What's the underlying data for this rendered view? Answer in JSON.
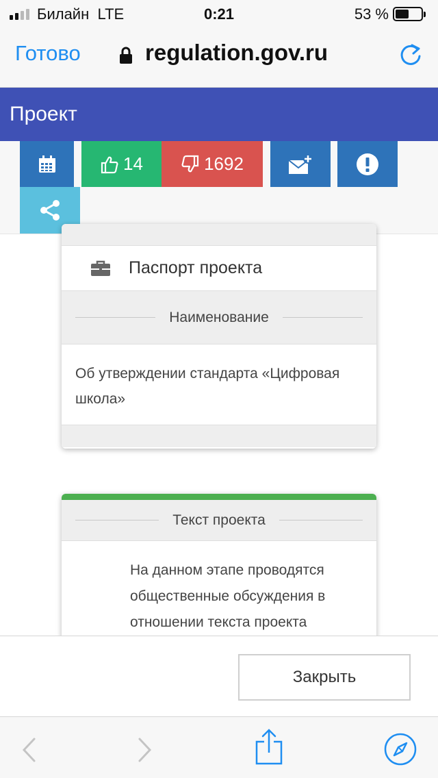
{
  "status_bar": {
    "carrier": "Билайн",
    "network": "LTE",
    "time": "0:21",
    "battery_percent": "53 %",
    "battery_level": 0.53,
    "signal_bars_filled": 2,
    "signal_bars_total": 4
  },
  "browser": {
    "done_label": "Готово",
    "url": "regulation.gov.ru",
    "lock_icon": "lock-icon",
    "reload_icon": "reload-icon"
  },
  "page": {
    "title": "Проект",
    "header_color": "#3f51b5"
  },
  "toolbar": {
    "calendar_icon": "calendar-icon",
    "likes": "14",
    "dislikes": "1692",
    "subscribe_icon": "envelope-plus-icon",
    "complaint_icon": "exclamation-icon",
    "share_icon": "share-icon",
    "colors": {
      "blue": "#2e73b9",
      "green": "#26b772",
      "red": "#d9534f",
      "light_blue": "#5bc0de"
    }
  },
  "passport_card": {
    "title": "Паспорт проекта",
    "icon": "briefcase-icon",
    "section_label": "Наименование",
    "name_text": "Об утверждении стандарта «Цифровая школа»"
  },
  "text_card": {
    "section_label": "Текст проекта",
    "body_text": "На данном этапе проводятся общественные обсуждения в отношении текста проекта",
    "accent_color": "#4caf50"
  },
  "close_button": {
    "label": "Закрыть"
  },
  "safari_toolbar": {
    "back_icon": "chevron-left-icon",
    "forward_icon": "chevron-right-icon",
    "share_icon": "share-up-icon",
    "compass_icon": "compass-icon"
  }
}
